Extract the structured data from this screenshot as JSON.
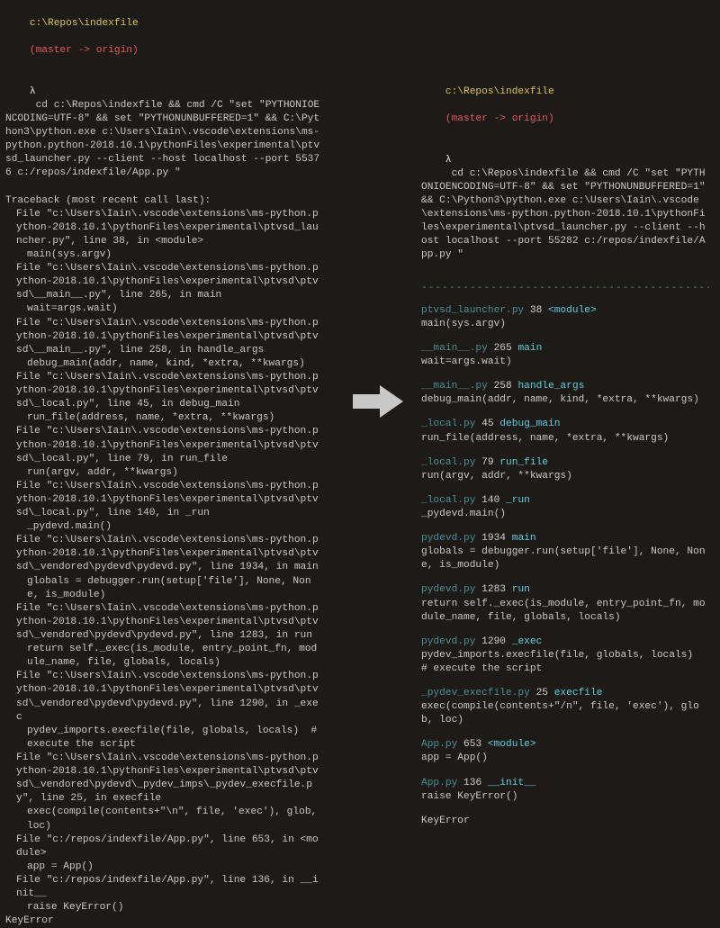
{
  "left": {
    "prompt_path": "c:\\Repos\\indexfile",
    "prompt_branch": "(master -> origin)",
    "lambda": "λ",
    "cmd": "cd c:\\Repos\\indexfile && cmd /C \"set \"PYTHONIOENCODING=UTF-8\" && set \"PYTHONUNBUFFERED=1\" && C:\\Python3\\python.exe c:\\Users\\Iain\\.vscode\\extensions\\ms-python.python-2018.10.1\\pythonFiles\\experimental\\ptvsd_launcher.py --client --host localhost --port 55376 c:/repos/indexfile/App.py \"",
    "traceback_header": "Traceback (most recent call last):",
    "frames": [
      {
        "loc": "File \"c:\\Users\\Iain\\.vscode\\extensions\\ms-python.python-2018.10.1\\pythonFiles\\experimental\\ptvsd_launcher.py\", line 38, in <module>",
        "code": "main(sys.argv)"
      },
      {
        "loc": "File \"c:\\Users\\Iain\\.vscode\\extensions\\ms-python.python-2018.10.1\\pythonFiles\\experimental\\ptvsd\\ptvsd\\__main__.py\", line 265, in main",
        "code": "wait=args.wait)"
      },
      {
        "loc": "File \"c:\\Users\\Iain\\.vscode\\extensions\\ms-python.python-2018.10.1\\pythonFiles\\experimental\\ptvsd\\ptvsd\\__main__.py\", line 258, in handle_args",
        "code": "debug_main(addr, name, kind, *extra, **kwargs)"
      },
      {
        "loc": "File \"c:\\Users\\Iain\\.vscode\\extensions\\ms-python.python-2018.10.1\\pythonFiles\\experimental\\ptvsd\\ptvsd\\_local.py\", line 45, in debug_main",
        "code": "run_file(address, name, *extra, **kwargs)"
      },
      {
        "loc": "File \"c:\\Users\\Iain\\.vscode\\extensions\\ms-python.python-2018.10.1\\pythonFiles\\experimental\\ptvsd\\ptvsd\\_local.py\", line 79, in run_file",
        "code": "run(argv, addr, **kwargs)"
      },
      {
        "loc": "File \"c:\\Users\\Iain\\.vscode\\extensions\\ms-python.python-2018.10.1\\pythonFiles\\experimental\\ptvsd\\ptvsd\\_local.py\", line 140, in _run",
        "code": "_pydevd.main()"
      },
      {
        "loc": "File \"c:\\Users\\Iain\\.vscode\\extensions\\ms-python.python-2018.10.1\\pythonFiles\\experimental\\ptvsd\\ptvsd\\_vendored\\pydevd\\pydevd.py\", line 1934, in main",
        "code": "globals = debugger.run(setup['file'], None, None, is_module)"
      },
      {
        "loc": "File \"c:\\Users\\Iain\\.vscode\\extensions\\ms-python.python-2018.10.1\\pythonFiles\\experimental\\ptvsd\\ptvsd\\_vendored\\pydevd\\pydevd.py\", line 1283, in run",
        "code": "return self._exec(is_module, entry_point_fn, module_name, file, globals, locals)"
      },
      {
        "loc": "File \"c:\\Users\\Iain\\.vscode\\extensions\\ms-python.python-2018.10.1\\pythonFiles\\experimental\\ptvsd\\ptvsd\\_vendored\\pydevd\\pydevd.py\", line 1290, in _exec",
        "code": "pydev_imports.execfile(file, globals, locals)  # execute the script"
      },
      {
        "loc": "File \"c:\\Users\\Iain\\.vscode\\extensions\\ms-python.python-2018.10.1\\pythonFiles\\experimental\\ptvsd\\ptvsd\\_vendored\\pydevd\\_pydev_imps\\_pydev_execfile.py\", line 25, in execfile",
        "code": "exec(compile(contents+\"\\n\", file, 'exec'), glob, loc)"
      },
      {
        "loc": "File \"c:/repos/indexfile/App.py\", line 653, in <module>",
        "code": "app = App()"
      },
      {
        "loc": "File \"c:/repos/indexfile/App.py\", line 136, in __init__",
        "code": "raise KeyError()"
      }
    ],
    "exception": "KeyError"
  },
  "right": {
    "prompt_path": "c:\\Repos\\indexfile",
    "prompt_branch": "(master -> origin)",
    "lambda": "λ",
    "cmd": "cd c:\\Repos\\indexfile && cmd /C \"set \"PYTHONIOENCODING=UTF-8\" && set \"PYTHONUNBUFFERED=1\" && C:\\Python3\\python.exe c:\\Users\\Iain\\.vscode\\extensions\\ms-python.python-2018.10.1\\pythonFiles\\experimental\\ptvsd_launcher.py --client --host localhost --port 55282 c:/repos/indexfile/App.py \"",
    "separator": "--------------------------------------------------",
    "frames": [
      {
        "file": "ptvsd_launcher.py",
        "line": "38",
        "func": "<module>",
        "code": "main(sys.argv)"
      },
      {
        "file": "__main__.py",
        "line": "265",
        "func": "main",
        "code": "wait=args.wait)"
      },
      {
        "file": "__main__.py",
        "line": "258",
        "func": "handle_args",
        "code": "debug_main(addr, name, kind, *extra, **kwargs)"
      },
      {
        "file": "_local.py",
        "line": "45",
        "func": "debug_main",
        "code": "run_file(address, name, *extra, **kwargs)"
      },
      {
        "file": "_local.py",
        "line": "79",
        "func": "run_file",
        "code": "run(argv, addr, **kwargs)"
      },
      {
        "file": "_local.py",
        "line": "140",
        "func": "_run",
        "code": "_pydevd.main()"
      },
      {
        "file": "pydevd.py",
        "line": "1934",
        "func": "main",
        "code": "globals = debugger.run(setup['file'], None, None, is_module)"
      },
      {
        "file": "pydevd.py",
        "line": "1283",
        "func": "run",
        "code": "return self._exec(is_module, entry_point_fn, module_name, file, globals, locals)"
      },
      {
        "file": "pydevd.py",
        "line": "1290",
        "func": "_exec",
        "code": "pydev_imports.execfile(file, globals, locals)  # execute the script"
      },
      {
        "file": "_pydev_execfile.py",
        "line": "25",
        "func": "execfile",
        "code": "exec(compile(contents+\"/n\", file, 'exec'), glob, loc)"
      },
      {
        "file": "App.py",
        "line": "653",
        "func": "<module>",
        "code": "app = App()"
      },
      {
        "file": "App.py",
        "line": "136",
        "func": "__init__",
        "code": "raise KeyError()"
      }
    ],
    "exception": "KeyError"
  }
}
